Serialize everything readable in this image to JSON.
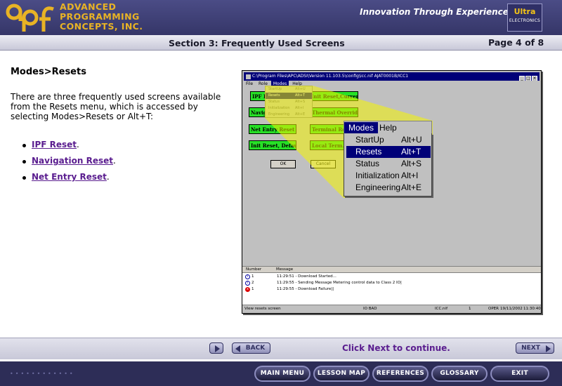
{
  "header": {
    "company_line1": "ADVANCED",
    "company_line2": "PROGRAMMING",
    "company_line3": "CONCEPTS, INC.",
    "tagline": "Innovation Through Experience",
    "ultra_top": "Ultra",
    "ultra_bottom": "ELECTRONICS",
    "logo_icon": "apc-logo",
    "colors": {
      "header_bg": "#3f4078",
      "logo_gold": "#e8b325"
    }
  },
  "subheader": {
    "section_title": "Section 3: Frequently Used Screens",
    "page": "Page 4 of 8"
  },
  "content": {
    "heading": "Modes>Resets",
    "intro": "There are three frequently used screens available from the Resets menu, which is accessed by selecting Modes>Resets or Alt+T:",
    "links": [
      {
        "label": "IPF Reset",
        "suffix": "."
      },
      {
        "label": "Navigation Reset",
        "suffix": "."
      },
      {
        "label": "Net Entry Reset",
        "suffix": "."
      }
    ],
    "link_color": "#5a1d8f"
  },
  "screenshot": {
    "title": "C:\\Program Files\\APC\\ADSI\\Version 11.103.5\\config\\icc.nif   AJAT0001B/ICC1",
    "menu": [
      "File",
      "Role",
      "Modes",
      "Help"
    ],
    "buttons": [
      "IPF Reset",
      "Init Reset,Current",
      "Navig...",
      "Thermal Override",
      "Net Entry Reset",
      "Terminal Re...",
      "Init Reset, Default",
      "Local Term..."
    ],
    "ok": "OK",
    "cancel": "Cancel",
    "small_menu": [
      {
        "label": "StartUp",
        "key": "Alt+U"
      },
      {
        "label": "Resets",
        "key": "Alt+T"
      },
      {
        "label": "Status",
        "key": "Alt+S"
      },
      {
        "label": "Initialization",
        "key": "Alt+I"
      },
      {
        "label": "Engineering",
        "key": "Alt+E"
      }
    ],
    "big_menu_bar": [
      "Modes",
      "Help"
    ],
    "big_menu": [
      {
        "label": "StartUp",
        "key": "Alt+U"
      },
      {
        "label": "Resets",
        "key": "Alt+T"
      },
      {
        "label": "Status",
        "key": "Alt+S"
      },
      {
        "label": "Initialization",
        "key": "Alt+I"
      },
      {
        "label": "Engineering",
        "key": "Alt+E"
      }
    ],
    "selected_item": "Resets",
    "log_headers": [
      "Number",
      "Message"
    ],
    "log": [
      {
        "n": "1",
        "text": "11:29:51 - Download Started...",
        "type": "info"
      },
      {
        "n": "2",
        "text": "11:29:55 - Sending Message Metering control data to Class 2 IO|",
        "type": "info"
      },
      {
        "n": "1",
        "text": "11:29:55 - Download Failure||",
        "type": "error"
      }
    ],
    "status": {
      "left": "View resets screen",
      "io": "IO BAD",
      "file": "ICC.nif",
      "num": "1",
      "mode": "OPER",
      "datetime": "19/11/2002",
      "time": "11:30:40"
    },
    "highlight_color": "#f4f400"
  },
  "nav": {
    "back": "BACK",
    "next": "NEXT",
    "continue_text": "Click Next to continue."
  },
  "footer": {
    "main_menu": "MAIN MENU",
    "lesson_map": "LESSON MAP",
    "references": "REFERENCES",
    "glossary": "GLOSSARY",
    "exit": "EXIT"
  }
}
